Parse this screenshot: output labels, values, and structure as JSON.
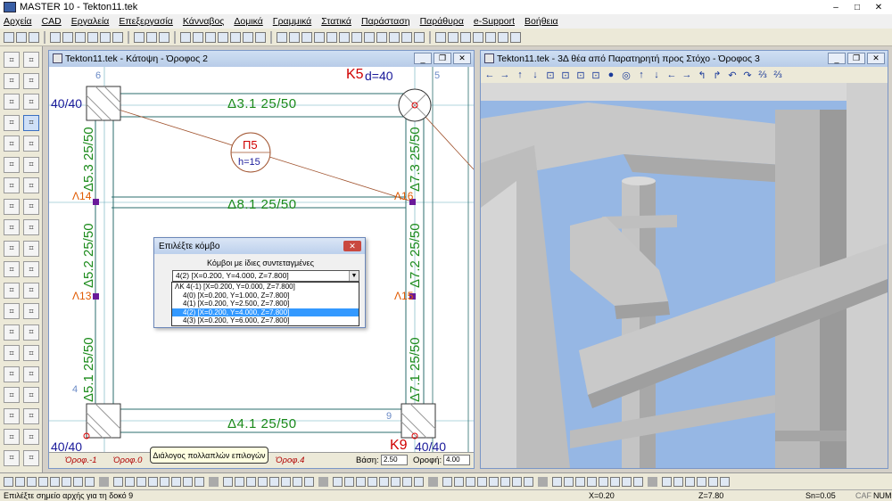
{
  "window": {
    "title": "MASTER 10 - Tekton11.tek",
    "min": "–",
    "max": "□",
    "close": "✕"
  },
  "menu": [
    "Αρχεία",
    "CAD",
    "Εργαλεία",
    "Επεξεργασία",
    "Κάνναβος",
    "Δομικά",
    "Γραμμικά",
    "Στατικά",
    "Παράσταση",
    "Παράθυρα",
    "e-Support",
    "Βοήθεια"
  ],
  "plan": {
    "title": "Tekton11.tek - Κάτοψη - Όροφος 2",
    "labels": {
      "beam_top": "Δ3.1  25/50",
      "beam_mid": "Δ8.1  25/50",
      "beam_bot": "Δ4.1  25/50",
      "col_tl": "40/40",
      "col_tr_k": "K5",
      "col_tr_d": "d=40",
      "col_bl": "40/40",
      "col_br_k": "K9",
      "col_br_s": "40/40",
      "slab_name": "Π5",
      "slab_h": "h=15",
      "v_left_top": "Δ5.3  25/50",
      "v_left_mid": "Δ5.2  25/50",
      "v_left_bot": "Δ5.1  25/50",
      "v_right_top": "Δ7.3  25/50",
      "v_right_mid": "Δ7.2  25/50",
      "v_right_bot": "Δ7.1  25/50",
      "n14": "Λ14",
      "n16": "Λ16",
      "n13": "Λ13",
      "n15": "Λ15",
      "num6": "6",
      "num5": "5",
      "num4": "4",
      "num9": "9"
    },
    "tabs": [
      "Όροφ.-1",
      "Όροφ.0",
      "Όροφ.4"
    ],
    "base_label": "Βάση:",
    "base_value": "2.50",
    "roof_label": "Οροφή:",
    "roof_value": "4.00"
  },
  "view3d": {
    "title": "Tekton11.tek - 3Δ θέα από Παρατηρητή προς Στόχο - Όροφος 3",
    "tool_icons": [
      "←",
      "→",
      "↑",
      "↓",
      "⊡",
      "⊡",
      "⊡",
      "⊡",
      "●",
      "◎",
      "↑",
      "↓",
      "←",
      "→",
      "↰",
      "↱",
      "↶",
      "↷",
      "⅔",
      "⅔"
    ]
  },
  "dialog": {
    "title": "Επιλέξτε κόμβο",
    "label": "Κόμβοι με ίδιες συντεταγμένες",
    "selected": "4(2) [X=0.200, Y=4.000, Z=7.800]",
    "close": "✕",
    "options": [
      "ΛΚ 4(-1) [X=0.200, Y=0.000, Z=7.800]",
      "4(0) [X=0.200, Y=1.000, Z=7.800]",
      "4(1) [X=0.200, Y=2.500, Z=7.800]",
      "4(2) [X=0.200, Y=4.000, Z=7.800]",
      "4(3) [X=0.200, Y=6.000, Z=7.800]"
    ]
  },
  "tooltip": "Διάλογος πολλαπλών επιλογών",
  "status": {
    "message": "Επιλέξτε σημείο αρχής για τη δοκό 9",
    "x": "X=0.20",
    "z": "Z=7.80",
    "sn": "Sn=0.05",
    "caf": "CAF",
    "num": "NUM"
  },
  "colors": {
    "beam_text": "#1a8a1a",
    "column_text": "#1a1a9a",
    "node_text": "#e05a00",
    "red": "#d00000",
    "sky": "#96b7e4",
    "concrete": "#cfcfcf"
  }
}
